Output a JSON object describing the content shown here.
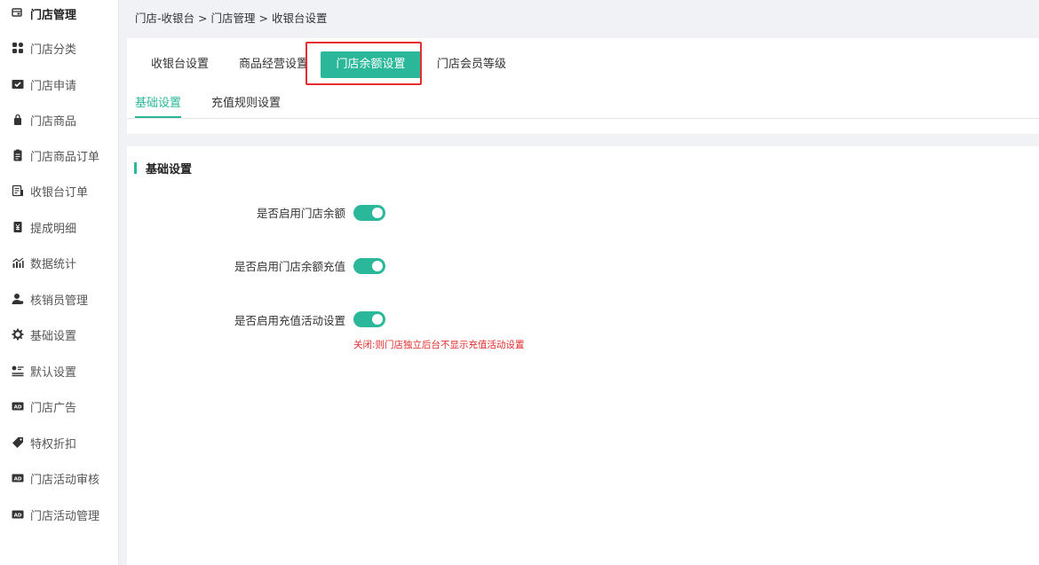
{
  "sidebar": {
    "header": {
      "label": "门店管理",
      "icon": "store-icon"
    },
    "items": [
      {
        "label": "门店分类",
        "icon": "category-icon"
      },
      {
        "label": "门店申请",
        "icon": "application-icon"
      },
      {
        "label": "门店商品",
        "icon": "product-bag-icon"
      },
      {
        "label": "门店商品订单",
        "icon": "order-clipboard-icon"
      },
      {
        "label": "收银台订单",
        "icon": "cashier-order-icon"
      },
      {
        "label": "提成明细",
        "icon": "commission-icon"
      },
      {
        "label": "数据统计",
        "icon": "statistics-icon"
      },
      {
        "label": "核销员管理",
        "icon": "staff-icon"
      },
      {
        "label": "基础设置",
        "icon": "gear-icon"
      },
      {
        "label": "默认设置",
        "icon": "default-settings-icon"
      },
      {
        "label": "门店广告",
        "icon": "ad-icon"
      },
      {
        "label": "特权折扣",
        "icon": "tag-icon"
      },
      {
        "label": "门店活动审核",
        "icon": "ad-icon"
      },
      {
        "label": "门店活动管理",
        "icon": "ad-icon"
      }
    ]
  },
  "breadcrumb": [
    "门店-收银台",
    ">",
    "门店管理",
    ">",
    "收银台设置"
  ],
  "tabs": [
    {
      "label": "收银台设置"
    },
    {
      "label": "商品经营设置"
    },
    {
      "label": "门店余额设置"
    },
    {
      "label": "门店会员等级"
    }
  ],
  "subtabs": [
    {
      "label": "基础设置"
    },
    {
      "label": "充值规则设置"
    }
  ],
  "section": {
    "title": "基础设置"
  },
  "form": {
    "fields": [
      {
        "label": "是否启用门店余额",
        "enabled": true
      },
      {
        "label": "是否启用门店余额充值",
        "enabled": true
      },
      {
        "label": "是否启用充值活动设置",
        "enabled": true,
        "hint": "关闭:则门店独立后台不显示充值活动设置"
      }
    ]
  },
  "colors": {
    "accent": "#2bb89a",
    "highlight": "#e62e2e",
    "hint": "#e02a2a"
  }
}
